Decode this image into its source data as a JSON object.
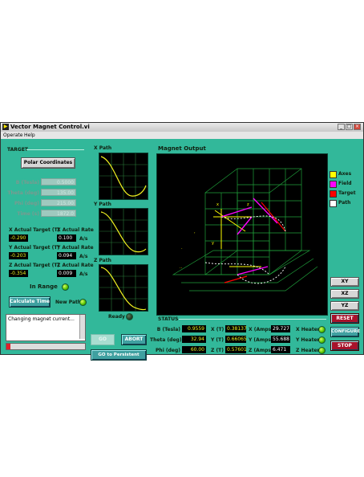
{
  "window": {
    "title": "Vector Magnet Control.vi",
    "minimize": "_",
    "maximize": "□",
    "close": "×"
  },
  "menu": [
    "Operate",
    "Help"
  ],
  "target": {
    "header": "TARGET",
    "polar_button": "Polar Coordinates",
    "fields": [
      {
        "label": "B (Tesla)",
        "value": "0.5000"
      },
      {
        "label": "Theta (deg)",
        "value": "135.00"
      },
      {
        "label": "Phi (deg)",
        "value": "215.00"
      },
      {
        "label": "Time (s)",
        "value": "1872.0"
      }
    ],
    "actual": [
      {
        "target_label": "X Actual Target (T)",
        "target_value": "-0.290",
        "rate_label": "X Actual Rate",
        "rate_value": "0.100",
        "unit": "A/s"
      },
      {
        "target_label": "Y Actual Target (T)",
        "target_value": "-0.203",
        "rate_label": "Y Actual Rate",
        "rate_value": "0.094",
        "unit": "A/s"
      },
      {
        "target_label": "Z Actual Target (T)",
        "target_value": "-0.354",
        "rate_label": "Z Actual Rate",
        "rate_value": "0.009",
        "unit": "A/s"
      }
    ],
    "in_range": "In Range",
    "calc_button": "Calculate Time",
    "new_path": "New Path",
    "log_text": "Changing magnet current...",
    "progress": 0.05
  },
  "paths": {
    "x": "X Path",
    "y": "Y Path",
    "z": "Z Path",
    "ready": "Ready"
  },
  "buttons": {
    "go": "GO",
    "abort": "ABORT",
    "persistent": "GO to Persistent Mode"
  },
  "magnet_output": {
    "header": "Magnet Output",
    "legend": [
      {
        "label": "Axes",
        "color": "#ffff00"
      },
      {
        "label": "Field",
        "color": "#ff00ff"
      },
      {
        "label": "Target",
        "color": "#ff0000"
      },
      {
        "label": "Path",
        "color": "#ffffff"
      }
    ]
  },
  "views": [
    "XY",
    "XZ",
    "YZ"
  ],
  "controls": {
    "reset": "RESET",
    "configure": "CONFIGURE",
    "stop": "STOP"
  },
  "status": {
    "header": "STATUS",
    "rows": [
      {
        "label": "B (Tesla)",
        "value": "0.9559",
        "axis": "X (T)",
        "tval": "0.38137",
        "alabel": "X (Amps)",
        "aval": "29.727",
        "heater": "X Heater"
      },
      {
        "label": "Theta (deg)",
        "value": "32.94",
        "axis": "Y (T)",
        "tval": "0.66065",
        "alabel": "Y (Amps)",
        "aval": "55.688",
        "heater": "Y Heater"
      },
      {
        "label": "Phi (deg)",
        "value": "60.00",
        "axis": "Z (T)",
        "tval": "0.57601",
        "alabel": "Z (Amps)",
        "aval": "6.471",
        "heater": "Z Heater"
      }
    ]
  }
}
